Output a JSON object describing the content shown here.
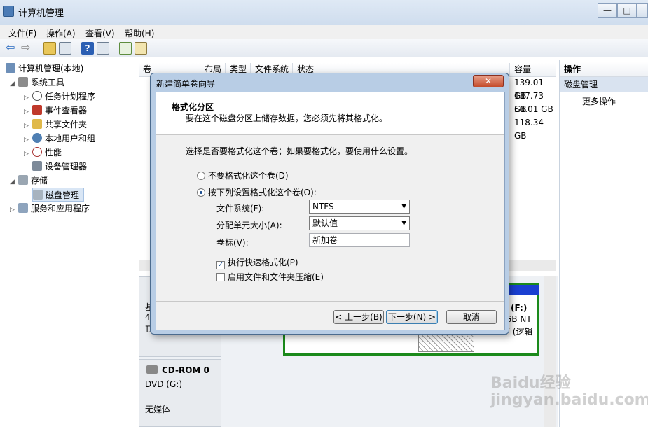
{
  "window": {
    "title": "计算机管理",
    "controls": {
      "minimize": "—",
      "maximize": "□",
      "close": "✕"
    }
  },
  "menu": [
    "文件(F)",
    "操作(A)",
    "查看(V)",
    "帮助(H)"
  ],
  "tree": {
    "root": "计算机管理(本地)",
    "system_tools": "系统工具",
    "task_scheduler": "任务计划程序",
    "event_viewer": "事件查看器",
    "shared_folders": "共享文件夹",
    "local_users": "本地用户和组",
    "performance": "性能",
    "device_manager": "设备管理器",
    "storage": "存储",
    "disk_management": "磁盘管理",
    "services_apps": "服务和应用程序"
  },
  "columns": [
    "卷",
    "布局",
    "类型",
    "文件系统",
    "状态",
    "容量"
  ],
  "capacities": [
    "139.01 GB",
    "137.73 GB",
    "50.01 GB",
    "118.34 GB"
  ],
  "lower": {
    "disk_partial": [
      "基",
      "4",
      "耳"
    ],
    "volume_letter": "(F:)",
    "volume_size": "GB NT",
    "volume_status": "F (逻辑",
    "cdrom_name": "CD-ROM 0",
    "cdrom_drive": "DVD (G:)",
    "cdrom_media": "无媒体"
  },
  "actions": {
    "header": "操作",
    "section": "磁盘管理",
    "more": "更多操作"
  },
  "dialog": {
    "title": "新建简单卷向导",
    "heading": "格式化分区",
    "subheading": "要在这个磁盘分区上储存数据，您必须先将其格式化。",
    "question": "选择是否要格式化这个卷；如果要格式化，要使用什么设置。",
    "option_no_format": "不要格式化这个卷(D)",
    "option_format": "按下列设置格式化这个卷(O):",
    "fs_label": "文件系统(F):",
    "fs_value": "NTFS",
    "alloc_label": "分配单元大小(A):",
    "alloc_value": "默认值",
    "volume_label": "卷标(V):",
    "volume_value": "新加卷",
    "quick_format": "执行快速格式化(P)",
    "compression": "启用文件和文件夹压缩(E)",
    "back": "< 上一步(B)",
    "next": "下一步(N) >",
    "cancel": "取消"
  },
  "watermark": "Baidu经验 jingyan.baidu.com"
}
